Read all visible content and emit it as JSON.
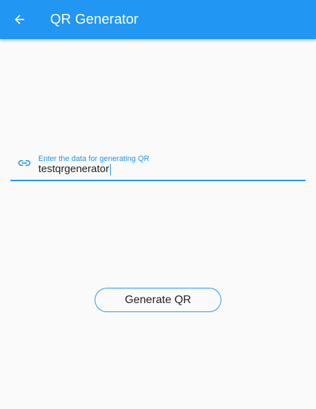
{
  "app_bar": {
    "title": "QR Generator",
    "back_icon": "arrow-back-icon",
    "background_color": "#2196f3",
    "text_color": "#ffffff"
  },
  "form": {
    "input": {
      "icon": "link-icon",
      "label": "Enter the data for generating QR",
      "value": "testqrgenerator",
      "accent_color": "#2196f3"
    },
    "button": {
      "label": "Generate QR",
      "border_color": "#2196f3"
    }
  },
  "theme": {
    "page_background": "#fafafa"
  }
}
